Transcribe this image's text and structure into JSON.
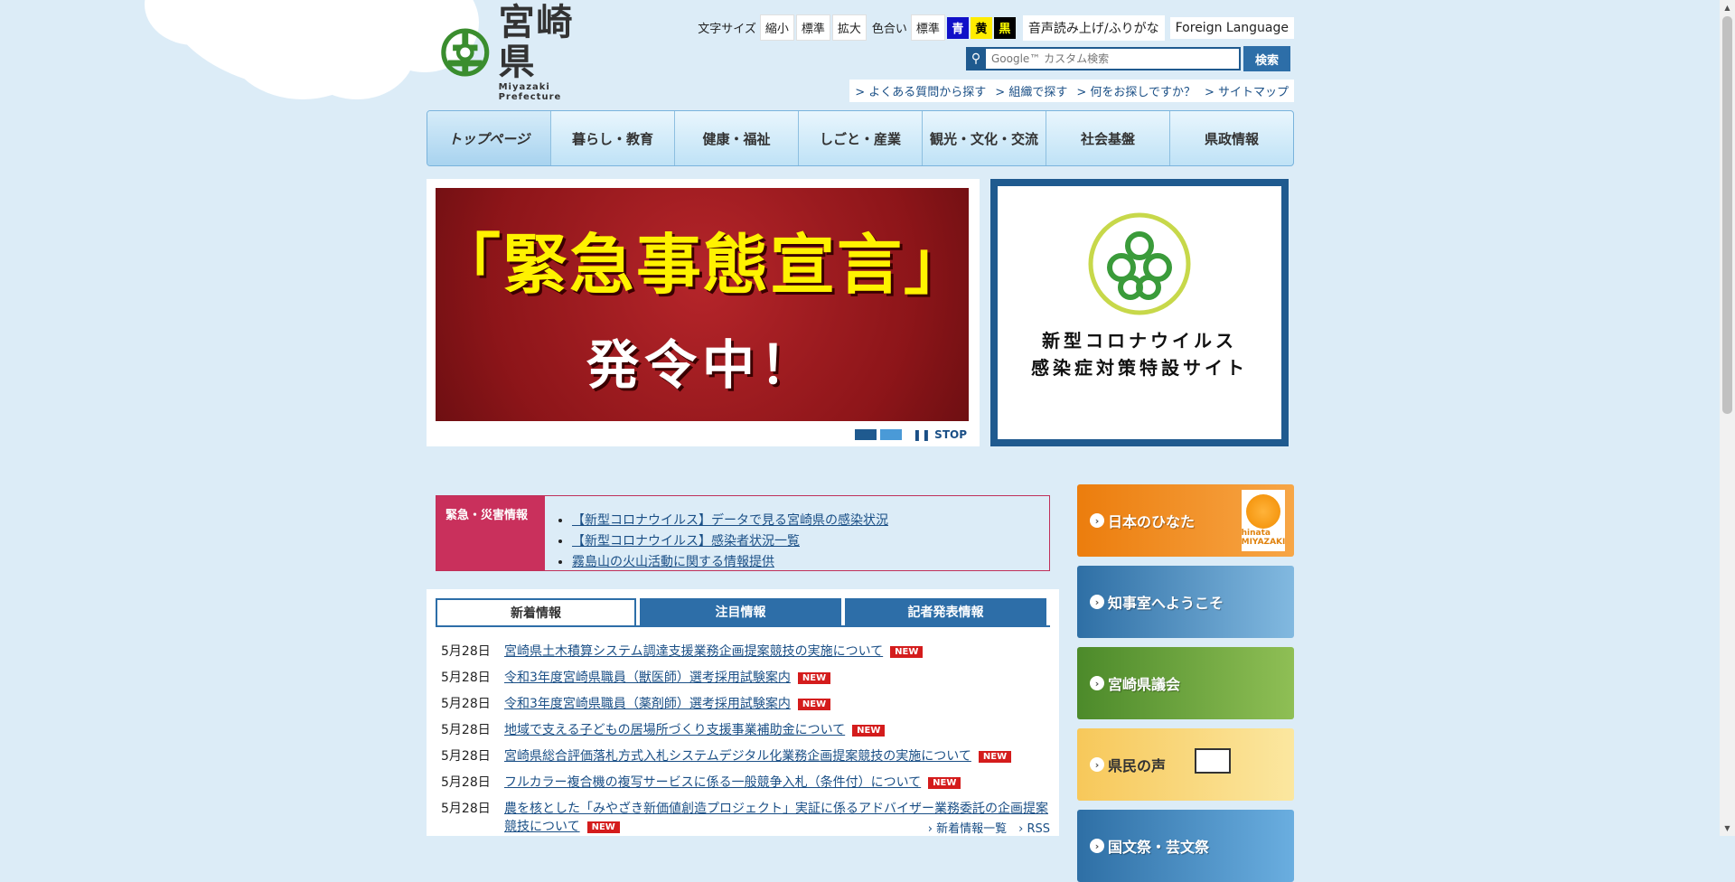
{
  "logo": {
    "ja": "宮崎県",
    "en": "Miyazaki Prefecture"
  },
  "util": {
    "font_size_label": "文字サイズ",
    "font_small": "縮小",
    "font_normal": "標準",
    "font_large": "拡大",
    "color_label": "色合い",
    "color_normal": "標準",
    "color_blue": "青",
    "color_yellow": "黄",
    "color_black": "黒",
    "voice": "音声読み上げ/ふりがな",
    "foreign": "Foreign Language"
  },
  "search": {
    "placeholder": "Google™ カスタム検索",
    "button": "検索"
  },
  "quick_links": [
    "> よくある質問から探す",
    "> 組織で探す",
    "> 何をお探しですか？",
    "> サイトマップ"
  ],
  "gnav": [
    "トップページ",
    "暮らし・教育",
    "健康・福祉",
    "しごと・産業",
    "観光・文化・交流",
    "社会基盤",
    "県政情報"
  ],
  "slider": {
    "line1": "「緊急事態宣言」",
    "line2": "発令中！",
    "stop": "STOP"
  },
  "corona": {
    "line1": "新型コロナウイルス",
    "line2": "感染症対策特設サイト"
  },
  "emergency": {
    "heading": "緊急・災害情報",
    "items": [
      "【新型コロナウイルス】データで見る宮崎県の感染状況",
      "【新型コロナウイルス】感染者状況一覧",
      "霧島山の火山活動に関する情報提供"
    ]
  },
  "news": {
    "tabs": [
      "新着情報",
      "注目情報",
      "記者発表情報"
    ],
    "new_badge": "NEW",
    "rows": [
      {
        "date": "5月28日",
        "title": "宮崎県土木積算システム調達支援業務企画提案競技の実施について"
      },
      {
        "date": "5月28日",
        "title": "令和3年度宮崎県職員（獣医師）選考採用試験案内"
      },
      {
        "date": "5月28日",
        "title": "令和3年度宮崎県職員（薬剤師）選考採用試験案内"
      },
      {
        "date": "5月28日",
        "title": "地域で支える子どもの居場所づくり支援事業補助金について"
      },
      {
        "date": "5月28日",
        "title": "宮崎県総合評価落札方式入札システムデジタル化業務企画提案競技の実施について"
      },
      {
        "date": "5月28日",
        "title": "フルカラー複合機の複写サービスに係る一般競争入札（条件付）について"
      },
      {
        "date": "5月28日",
        "title": "農を核とした「みやざき新価値創造プロジェクト」実証に係るアドバイザー業務委託の企画提案競技について"
      }
    ],
    "more": "› 新着情報一覧　› RSS"
  },
  "banners": [
    {
      "label": "日本のひなた",
      "badge": "hinata MIYAZAKI"
    },
    {
      "label": "知事室へようこそ"
    },
    {
      "label": "宮崎県議会"
    },
    {
      "label": "県民の声"
    },
    {
      "label": "国文祭・芸文祭"
    }
  ],
  "colors": {
    "accent": "#2d6ea8",
    "emergency": "#c9305c",
    "new_badge": "#d41c1c"
  }
}
